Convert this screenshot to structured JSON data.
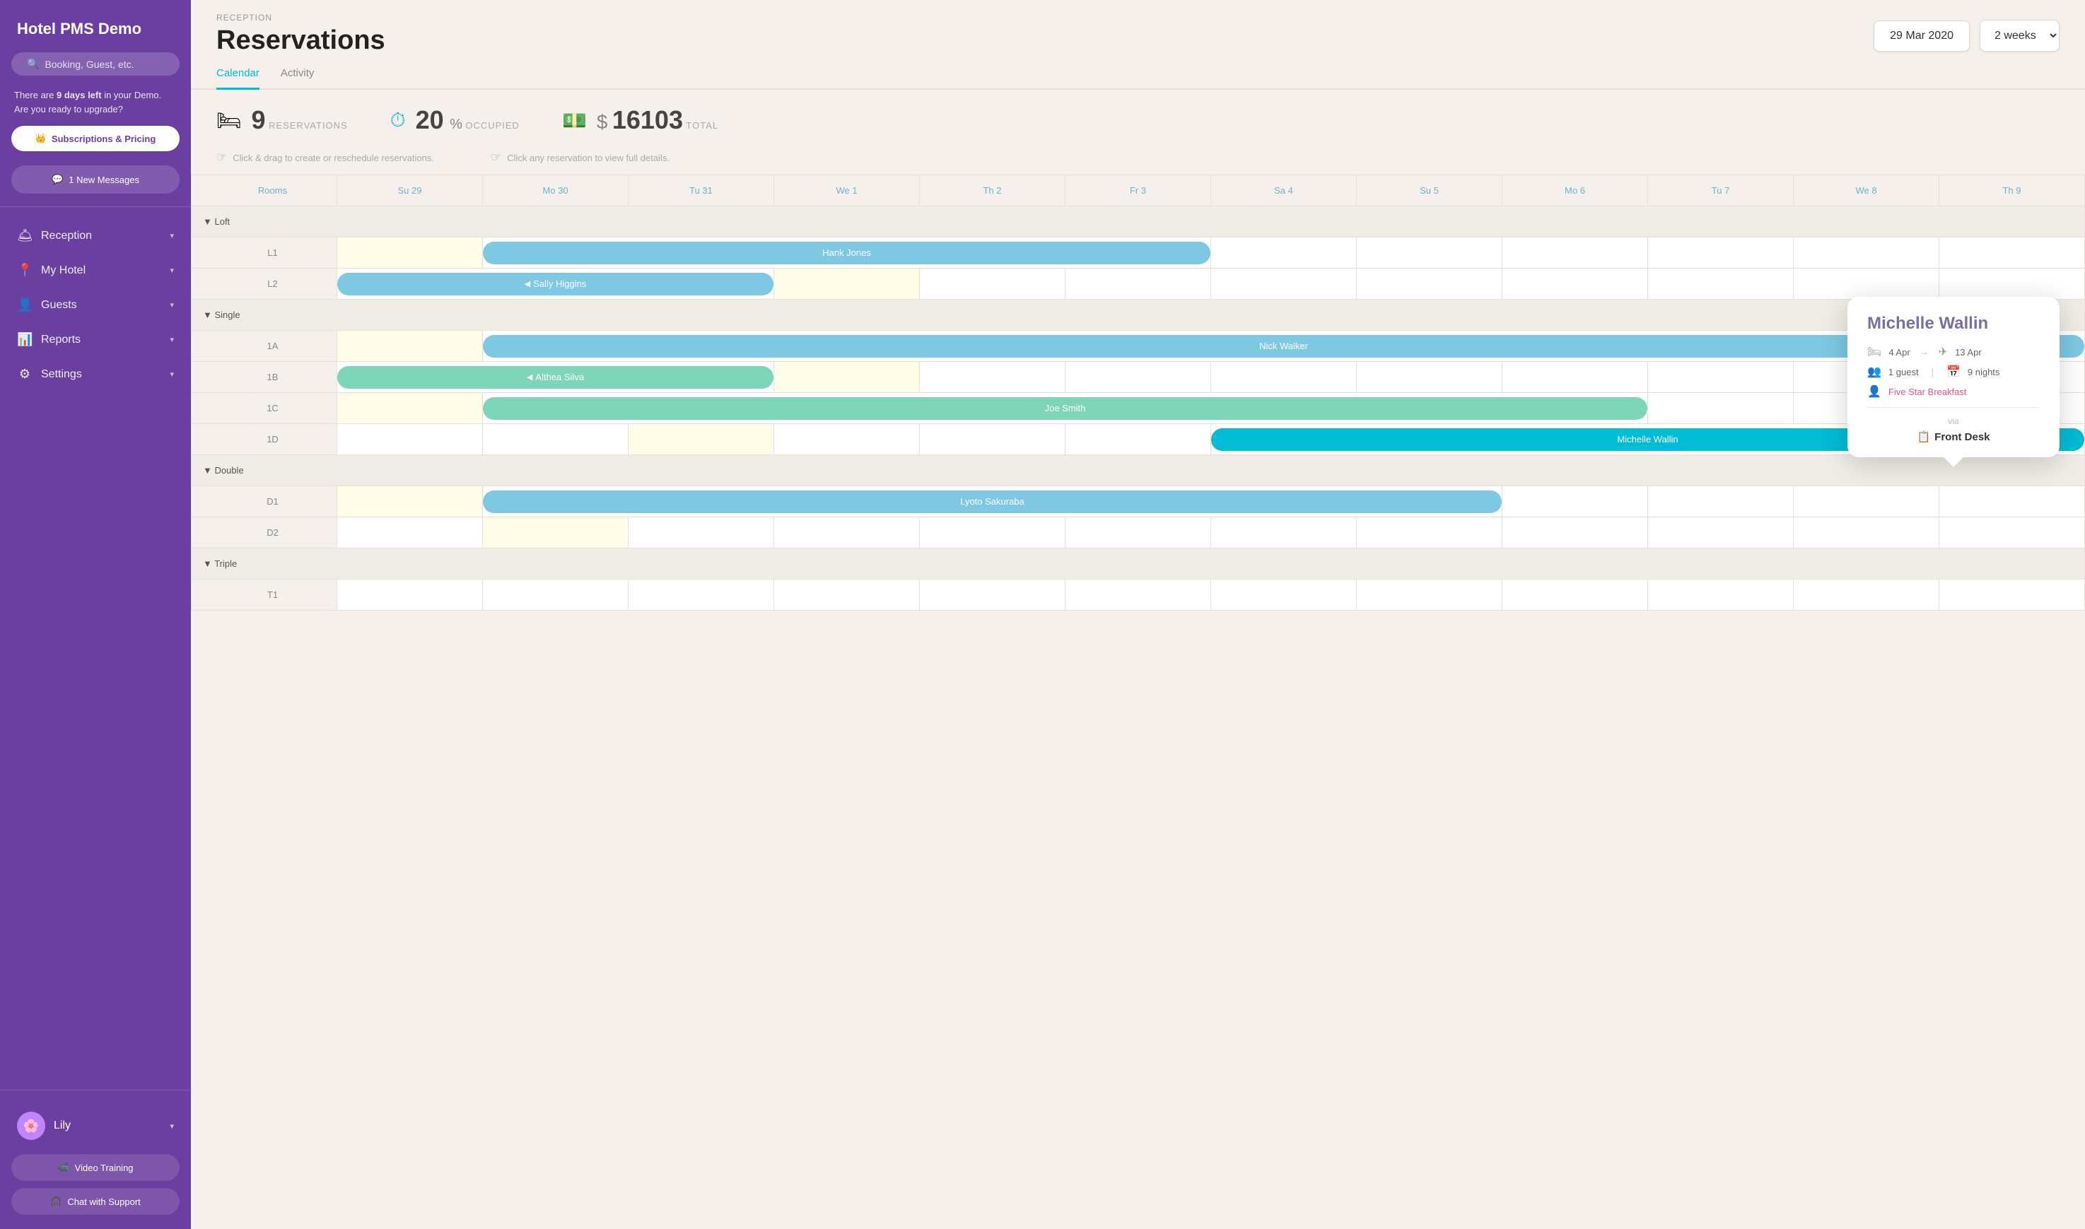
{
  "sidebar": {
    "logo": "Hotel PMS Demo",
    "search_placeholder": "Booking, Guest, etc.",
    "demo_msg_pre": "There are ",
    "demo_days": "9 days left",
    "demo_msg_post": " in your Demo. Are you ready to upgrade?",
    "upgrade_btn": "Subscriptions & Pricing",
    "messages_btn": "1 New Messages",
    "nav_items": [
      {
        "id": "reception",
        "icon": "🛎",
        "label": "Reception"
      },
      {
        "id": "myhotel",
        "icon": "📍",
        "label": "My Hotel"
      },
      {
        "id": "guests",
        "icon": "👤",
        "label": "Guests"
      },
      {
        "id": "reports",
        "icon": "📊",
        "label": "Reports"
      },
      {
        "id": "settings",
        "icon": "⚙",
        "label": "Settings"
      }
    ],
    "user": {
      "name": "Lily",
      "avatar": "🌸"
    },
    "training_btn": "Video Training",
    "chat_btn": "Chat with Support"
  },
  "header": {
    "breadcrumb": "RECEPTION",
    "title": "Reservations",
    "date": "29 Mar 2020",
    "weeks": "2 weeks"
  },
  "tabs": [
    {
      "label": "Calendar",
      "active": true
    },
    {
      "label": "Activity",
      "active": false
    }
  ],
  "stats": {
    "reservations": {
      "icon": "🛏",
      "value": "9",
      "label": "RESERVATIONS"
    },
    "occupied": {
      "icon": "🕐",
      "value": "20",
      "unit": "%",
      "label": "OCCUPIED"
    },
    "total": {
      "icon": "💵",
      "dollar": "$",
      "value": "16103",
      "label": "TOTAL"
    }
  },
  "hints": [
    "Click & drag to create or reschedule reservations.",
    "Click any reservation to view full details."
  ],
  "calendar": {
    "rooms_header": "Rooms",
    "day_headers": [
      "Su 29",
      "Mo 30",
      "Tu 31",
      "We 1",
      "Th 2",
      "Fr 3",
      "Sa 4",
      "Su 5",
      "Mo 6",
      "Tu 7",
      "We 8",
      "Th 9"
    ],
    "groups": [
      {
        "name": "▼ Loft",
        "rooms": [
          {
            "id": "L1",
            "reservation": {
              "name": "Hank Jones",
              "color": "blue",
              "start": 1,
              "span": 5
            }
          },
          {
            "id": "L2",
            "reservation": {
              "name": "◀ Sally Higgins",
              "color": "blue",
              "start": 0,
              "span": 3,
              "arrow_left": true
            }
          }
        ]
      },
      {
        "name": "▼ Single",
        "rooms": [
          {
            "id": "1A",
            "reservation": {
              "name": "Nick Walker",
              "color": "blue",
              "start": 1,
              "span": 11
            }
          },
          {
            "id": "1B",
            "reservation": {
              "name": "◀ Althea Silva",
              "color": "green",
              "start": 0,
              "span": 3,
              "arrow_left": true
            }
          },
          {
            "id": "1C",
            "reservation": {
              "name": "Joe Smith",
              "color": "green",
              "start": 1,
              "span": 8
            }
          },
          {
            "id": "1D",
            "reservation": {
              "name": "Michelle Wallin",
              "color": "cyan",
              "start": 6,
              "span": 6
            }
          }
        ]
      },
      {
        "name": "▼ Double",
        "rooms": [
          {
            "id": "D1",
            "reservation": {
              "name": "Lyoto Sakuraba",
              "color": "blue",
              "start": 1,
              "span": 7
            }
          },
          {
            "id": "D2",
            "reservation": null
          }
        ]
      },
      {
        "name": "▼ Triple",
        "rooms": [
          {
            "id": "T1",
            "reservation": null
          }
        ]
      }
    ]
  },
  "tooltip": {
    "name": "Michelle Wallin",
    "check_in": "4 Apr",
    "check_out": "13 Apr",
    "guests": "1 guest",
    "nights": "9 nights",
    "package": "Five Star Breakfast",
    "via_label": "via",
    "source": "Front Desk"
  }
}
